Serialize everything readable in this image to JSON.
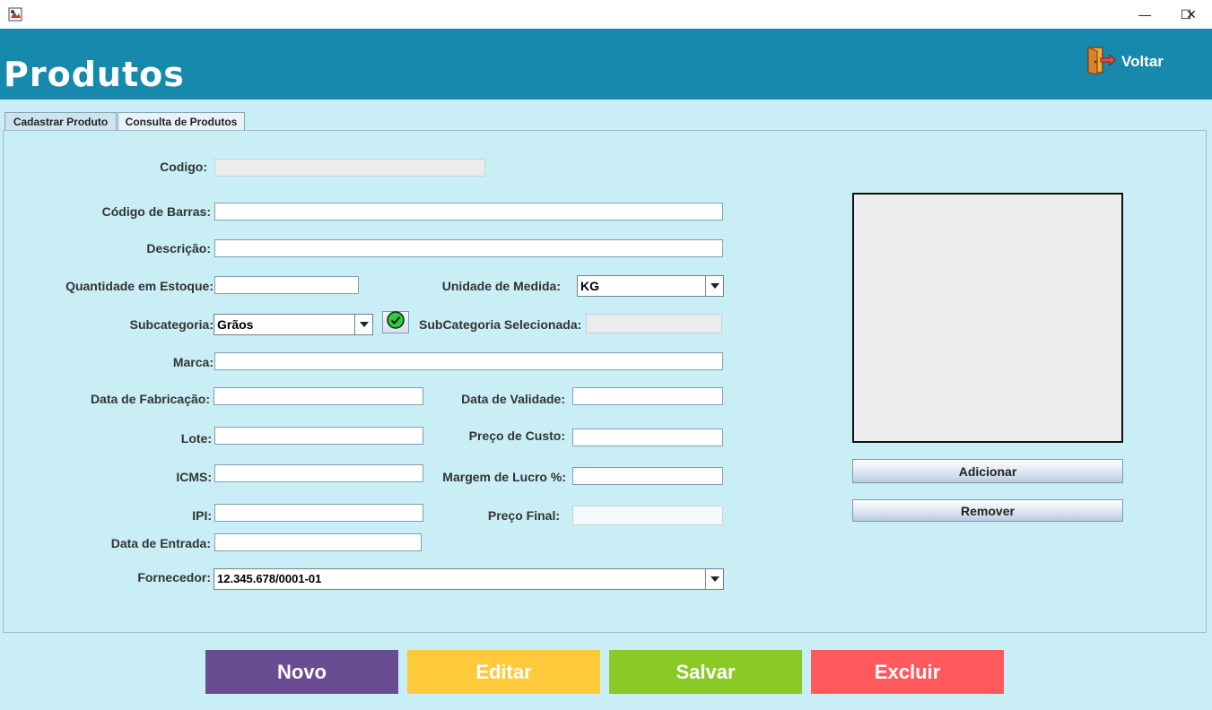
{
  "window": {
    "minimize_glyph": "—",
    "maximize_glyph": "☐",
    "close_glyph": "✕"
  },
  "header": {
    "title": "Produtos",
    "back_label": "Voltar",
    "bg_color": "#1689ad"
  },
  "tabs": [
    {
      "label": "Cadastrar Produto",
      "selected": true
    },
    {
      "label": "Consulta de Produtos",
      "selected": false
    }
  ],
  "form": {
    "codigo": {
      "label": "Codigo:",
      "value": ""
    },
    "codigo_barras": {
      "label": "Código de Barras:",
      "value": ""
    },
    "descricao": {
      "label": "Descrição:",
      "value": ""
    },
    "quantidade": {
      "label": "Quantidade em Estoque:",
      "value": ""
    },
    "unidade": {
      "label": "Unidade de Medida:",
      "value": "KG"
    },
    "subcategoria": {
      "label": "Subcategoria:",
      "value": "Grãos"
    },
    "subcategoria_selecionada": {
      "label": "SubCategoria Selecionada:",
      "value": ""
    },
    "marca": {
      "label": "Marca:",
      "value": ""
    },
    "data_fabricacao": {
      "label": "Data de Fabricação:",
      "value": ""
    },
    "data_validade": {
      "label": "Data de Validade:",
      "value": ""
    },
    "lote": {
      "label": "Lote:",
      "value": ""
    },
    "preco_custo": {
      "label": "Preço de Custo:",
      "value": ""
    },
    "icms": {
      "label": "ICMS:",
      "value": ""
    },
    "margem_lucro": {
      "label": "Margem de Lucro %:",
      "value": ""
    },
    "ipi": {
      "label": "IPI:",
      "value": ""
    },
    "preco_final": {
      "label": "Preço Final:",
      "value": ""
    },
    "data_entrada": {
      "label": "Data de Entrada:",
      "value": ""
    },
    "fornecedor": {
      "label": "Fornecedor:",
      "value": "12.345.678/0001-01"
    }
  },
  "image_panel": {
    "add_label": "Adicionar",
    "remove_label": "Remover"
  },
  "actions": {
    "novo": {
      "label": "Novo",
      "color": "#6a4c93"
    },
    "editar": {
      "label": "Editar",
      "color": "#ffca3a"
    },
    "salvar": {
      "label": "Salvar",
      "color": "#8ac926"
    },
    "excluir": {
      "label": "Excluir",
      "color": "#ff595e"
    }
  }
}
